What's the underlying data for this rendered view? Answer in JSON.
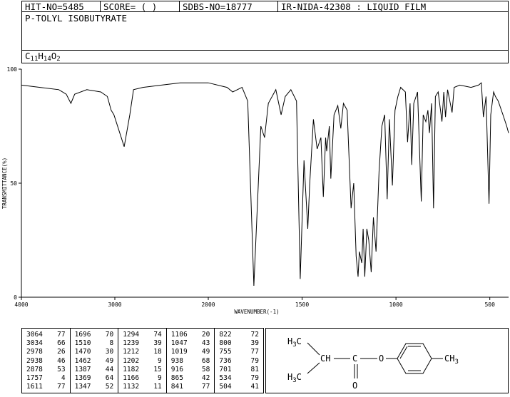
{
  "header": {
    "hit_no": "HIT-NO=5485",
    "score": "SCORE=  (   )",
    "sdbs_no": "SDBS-NO=18777",
    "ir_info": "IR-NIDA-42308 : LIQUID FILM"
  },
  "compound": {
    "name": "P-TOLYL ISOBUTYRATE",
    "formula_parts": [
      "C",
      "11",
      "H",
      "14",
      "O",
      "2"
    ]
  },
  "structure": {
    "ch3_top": "H3C",
    "ch3_bottom": "H3C",
    "ch": "CH",
    "c": "C",
    "o_ester": "O",
    "o_carbonyl": "O",
    "ch3_ring": "CH3"
  },
  "peak_table": {
    "columns": [
      [
        [
          "3064",
          "77"
        ],
        [
          "3034",
          "66"
        ],
        [
          "2978",
          "26"
        ],
        [
          "2938",
          "46"
        ],
        [
          "2878",
          "53"
        ],
        [
          "1757",
          "4"
        ],
        [
          "1611",
          "77"
        ]
      ],
      [
        [
          "1696",
          "70"
        ],
        [
          "1510",
          "8"
        ],
        [
          "1470",
          "30"
        ],
        [
          "1462",
          "49"
        ],
        [
          "1387",
          "44"
        ],
        [
          "1369",
          "64"
        ],
        [
          "1347",
          "52"
        ]
      ],
      [
        [
          "1294",
          "74"
        ],
        [
          "1239",
          "39"
        ],
        [
          "1212",
          "18"
        ],
        [
          "1202",
          "9"
        ],
        [
          "1182",
          "15"
        ],
        [
          "1166",
          "9"
        ],
        [
          "1132",
          "11"
        ]
      ],
      [
        [
          "1106",
          "20"
        ],
        [
          "1047",
          "43"
        ],
        [
          "1019",
          "49"
        ],
        [
          "938",
          "68"
        ],
        [
          "916",
          "58"
        ],
        [
          "865",
          "42"
        ],
        [
          "841",
          "77"
        ]
      ],
      [
        [
          "822",
          "72"
        ],
        [
          "800",
          "39"
        ],
        [
          "755",
          "77"
        ],
        [
          "736",
          "79"
        ],
        [
          "701",
          "81"
        ],
        [
          "534",
          "79"
        ],
        [
          "504",
          "41"
        ]
      ]
    ]
  },
  "chart_data": {
    "type": "line",
    "xlabel": "WAVENUMBER(-1)",
    "ylabel": "TRANSMITTANCE(%)",
    "xlim": [
      4000,
      400
    ],
    "ylim": [
      0,
      100
    ],
    "x_ticks": [
      "4000",
      "3000",
      "2000",
      "1500",
      "1000",
      "500"
    ],
    "y_ticks": [
      "0",
      "50",
      "100"
    ],
    "grid": false,
    "series": [
      {
        "color": "#000000",
        "baseline_points": [
          [
            4000,
            93
          ],
          [
            3800,
            92
          ],
          [
            3600,
            91
          ],
          [
            3520,
            89
          ],
          [
            3470,
            85
          ],
          [
            3430,
            89
          ],
          [
            3300,
            91
          ],
          [
            3150,
            90
          ],
          [
            3080,
            88
          ],
          [
            3040,
            82
          ],
          [
            3010,
            80
          ],
          [
            2900,
            66
          ],
          [
            2840,
            80
          ],
          [
            2800,
            91
          ],
          [
            2700,
            92
          ],
          [
            2500,
            93
          ],
          [
            2300,
            94
          ],
          [
            2000,
            94
          ],
          [
            1900,
            92
          ],
          [
            1870,
            90
          ],
          [
            1820,
            92
          ],
          [
            1790,
            86
          ],
          [
            1757,
            5
          ],
          [
            1720,
            75
          ],
          [
            1700,
            70
          ],
          [
            1680,
            85
          ],
          [
            1640,
            91
          ],
          [
            1612,
            80
          ],
          [
            1590,
            88
          ],
          [
            1560,
            91
          ],
          [
            1530,
            86
          ],
          [
            1510,
            8
          ],
          [
            1490,
            60
          ],
          [
            1470,
            30
          ],
          [
            1460,
            49
          ],
          [
            1440,
            78
          ],
          [
            1420,
            65
          ],
          [
            1400,
            70
          ],
          [
            1387,
            44
          ],
          [
            1375,
            70
          ],
          [
            1369,
            64
          ],
          [
            1355,
            75
          ],
          [
            1347,
            52
          ],
          [
            1330,
            80
          ],
          [
            1310,
            84
          ],
          [
            1294,
            74
          ],
          [
            1280,
            85
          ],
          [
            1260,
            82
          ],
          [
            1239,
            39
          ],
          [
            1225,
            50
          ],
          [
            1212,
            18
          ],
          [
            1202,
            9
          ],
          [
            1195,
            20
          ],
          [
            1182,
            15
          ],
          [
            1175,
            30
          ],
          [
            1166,
            9
          ],
          [
            1155,
            30
          ],
          [
            1145,
            25
          ],
          [
            1132,
            11
          ],
          [
            1120,
            35
          ],
          [
            1106,
            20
          ],
          [
            1090,
            55
          ],
          [
            1075,
            75
          ],
          [
            1060,
            80
          ],
          [
            1047,
            43
          ],
          [
            1035,
            78
          ],
          [
            1019,
            49
          ],
          [
            1005,
            82
          ],
          [
            990,
            88
          ],
          [
            975,
            92
          ],
          [
            950,
            90
          ],
          [
            938,
            68
          ],
          [
            925,
            85
          ],
          [
            916,
            58
          ],
          [
            905,
            85
          ],
          [
            885,
            90
          ],
          [
            865,
            42
          ],
          [
            855,
            80
          ],
          [
            841,
            77
          ],
          [
            830,
            82
          ],
          [
            822,
            72
          ],
          [
            810,
            85
          ],
          [
            800,
            39
          ],
          [
            790,
            88
          ],
          [
            775,
            90
          ],
          [
            755,
            77
          ],
          [
            745,
            90
          ],
          [
            736,
            79
          ],
          [
            725,
            91
          ],
          [
            701,
            81
          ],
          [
            690,
            92
          ],
          [
            660,
            93
          ],
          [
            600,
            92
          ],
          [
            560,
            93
          ],
          [
            545,
            94
          ],
          [
            534,
            79
          ],
          [
            520,
            88
          ],
          [
            504,
            41
          ],
          [
            495,
            80
          ],
          [
            480,
            90
          ],
          [
            470,
            88
          ],
          [
            455,
            86
          ],
          [
            430,
            80
          ],
          [
            410,
            75
          ],
          [
            400,
            72
          ]
        ]
      }
    ]
  }
}
